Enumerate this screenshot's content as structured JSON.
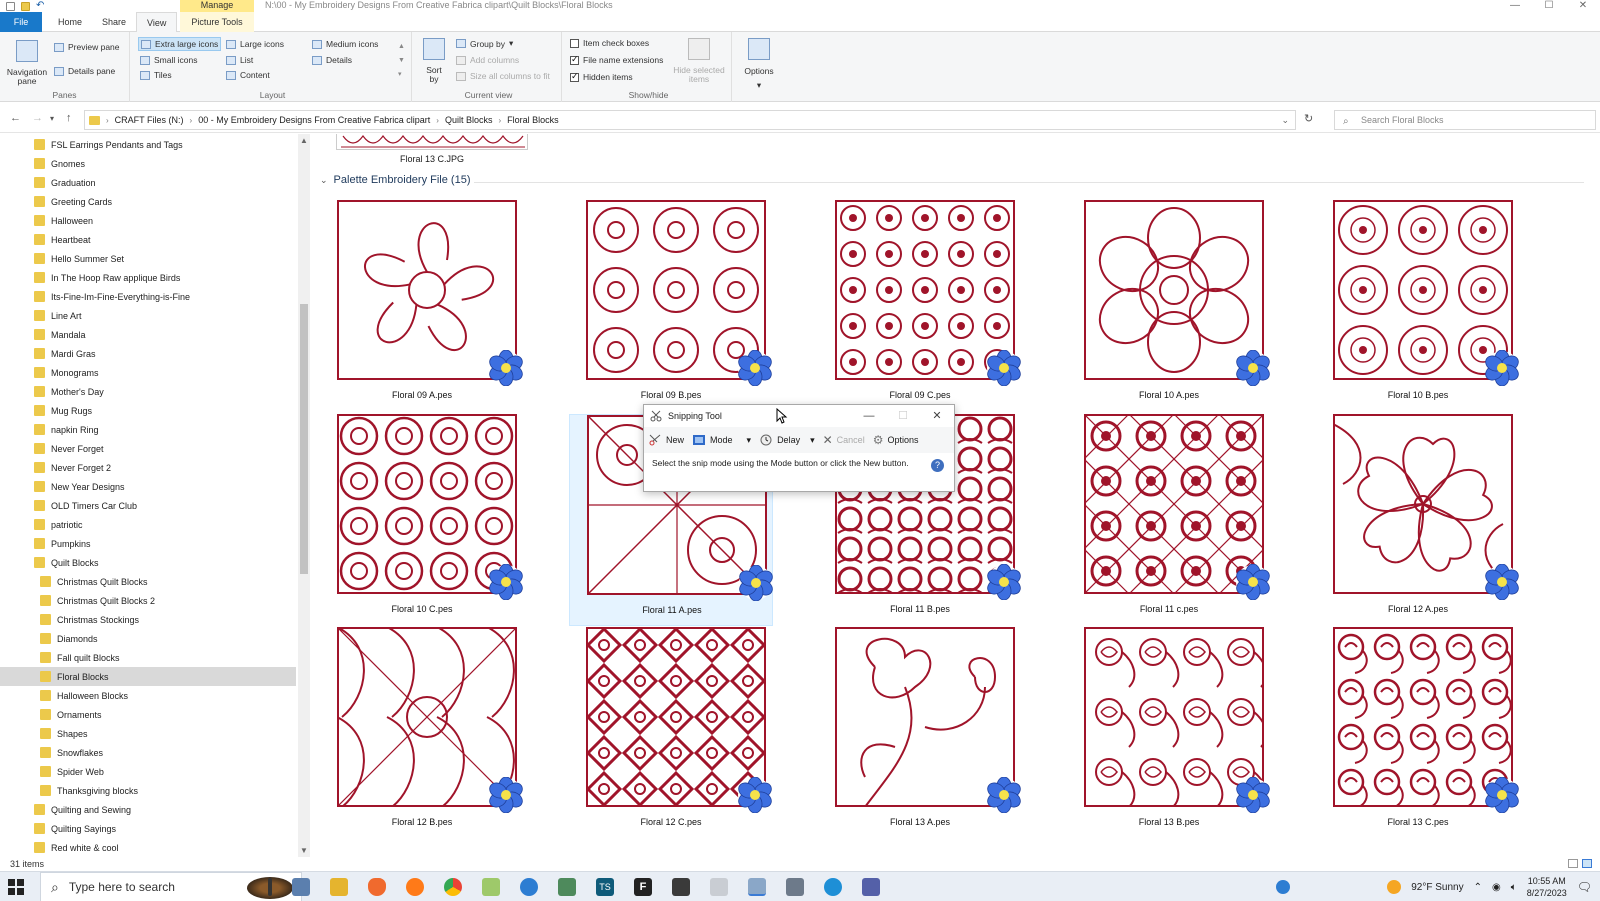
{
  "titlebar": {
    "manage_label": "Manage",
    "path": "N:\\00 - My Embroidery Designs From Creative Fabrica clipart\\Quilt Blocks\\Floral Blocks",
    "min": "—",
    "max": "☐",
    "close": "✕"
  },
  "tabs": {
    "file": "File",
    "home": "Home",
    "share": "Share",
    "view": "View",
    "picture_tools": "Picture Tools"
  },
  "ribbon": {
    "panes": {
      "label": "Panes",
      "navigation_pane": "Navigation pane",
      "preview_pane": "Preview pane",
      "details_pane": "Details pane"
    },
    "layout": {
      "label": "Layout",
      "extra_large_icons": "Extra large icons",
      "large_icons": "Large icons",
      "medium_icons": "Medium icons",
      "small_icons": "Small icons",
      "list": "List",
      "details": "Details",
      "tiles": "Tiles",
      "content": "Content"
    },
    "current_view": {
      "label": "Current view",
      "sort_by": "Sort by",
      "group_by": "Group by",
      "add_columns": "Add columns",
      "size_all_columns": "Size all columns to fit"
    },
    "show_hide": {
      "label": "Show/hide",
      "item_check_boxes": "Item check boxes",
      "file_name_extensions": "File name extensions",
      "hidden_items": "Hidden items",
      "hide_selected_items": "Hide selected items",
      "item_check_boxes_checked": false,
      "file_name_extensions_checked": true,
      "hidden_items_checked": true
    },
    "options": "Options"
  },
  "address": {
    "crumbs": [
      "CRAFT Files (N:)",
      "00 - My Embroidery Designs From Creative Fabrica clipart",
      "Quilt Blocks",
      "Floral Blocks"
    ],
    "search_placeholder": "Search Floral Blocks"
  },
  "navpane": {
    "items": [
      {
        "label": "FSL Earrings Pendants and Tags",
        "indent": 0
      },
      {
        "label": "Gnomes",
        "indent": 0
      },
      {
        "label": "Graduation",
        "indent": 0
      },
      {
        "label": "Greeting Cards",
        "indent": 0
      },
      {
        "label": "Halloween",
        "indent": 0
      },
      {
        "label": "Heartbeat",
        "indent": 0
      },
      {
        "label": "Hello Summer Set",
        "indent": 0
      },
      {
        "label": "In The Hoop Raw applique Birds",
        "indent": 0
      },
      {
        "label": "Its-Fine-Im-Fine-Everything-is-Fine",
        "indent": 0
      },
      {
        "label": "Line Art",
        "indent": 0
      },
      {
        "label": "Mandala",
        "indent": 0
      },
      {
        "label": "Mardi Gras",
        "indent": 0
      },
      {
        "label": "Monograms",
        "indent": 0
      },
      {
        "label": "Mother's Day",
        "indent": 0
      },
      {
        "label": "Mug Rugs",
        "indent": 0
      },
      {
        "label": "napkin Ring",
        "indent": 0
      },
      {
        "label": "Never Forget",
        "indent": 0
      },
      {
        "label": "Never Forget 2",
        "indent": 0
      },
      {
        "label": "New Year Designs",
        "indent": 0
      },
      {
        "label": "OLD Timers Car Club",
        "indent": 0
      },
      {
        "label": "patriotic",
        "indent": 0
      },
      {
        "label": "Pumpkins",
        "indent": 0
      },
      {
        "label": "Quilt Blocks",
        "indent": 0
      },
      {
        "label": "Christmas Quilt Blocks",
        "indent": 1
      },
      {
        "label": "Christmas Quilt Blocks 2",
        "indent": 1
      },
      {
        "label": "Christmas Stockings",
        "indent": 1
      },
      {
        "label": "Diamonds",
        "indent": 1
      },
      {
        "label": "Fall quilt Blocks",
        "indent": 1
      },
      {
        "label": "Floral Blocks",
        "indent": 1,
        "selected": true
      },
      {
        "label": "Halloween Blocks",
        "indent": 1
      },
      {
        "label": "Ornaments",
        "indent": 1
      },
      {
        "label": "Shapes",
        "indent": 1
      },
      {
        "label": "Snowflakes",
        "indent": 1
      },
      {
        "label": "Spider Web",
        "indent": 1
      },
      {
        "label": "Thanksgiving blocks",
        "indent": 1
      },
      {
        "label": "Quilting and Sewing",
        "indent": 0
      },
      {
        "label": "Quilting Sayings",
        "indent": 0
      },
      {
        "label": "Red white & cool",
        "indent": 0
      }
    ]
  },
  "content": {
    "prev_file_label": "Floral 13 C.JPG",
    "group_header": "Palette Embroidery File (15)",
    "files": [
      {
        "label": "Floral 09 A.pes",
        "pattern": "flower5"
      },
      {
        "label": "Floral 09 B.pes",
        "pattern": "quatrefoil"
      },
      {
        "label": "Floral 09 C.pes",
        "pattern": "smallflowers"
      },
      {
        "label": "Floral 10 A.pes",
        "pattern": "bigflower"
      },
      {
        "label": "Floral 10 B.pes",
        "pattern": "medallion"
      },
      {
        "label": "Floral 10 C.pes",
        "pattern": "grid9"
      },
      {
        "label": "Floral 11 A.pes",
        "pattern": "diag",
        "hover": true
      },
      {
        "label": "Floral 11 B.pes",
        "pattern": "dense"
      },
      {
        "label": "Floral 11 c.pes",
        "pattern": "lattice"
      },
      {
        "label": "Floral 12 A.pes",
        "pattern": "hibiscus"
      },
      {
        "label": "Floral 12 B.pes",
        "pattern": "leaves"
      },
      {
        "label": "Floral 12 C.pes",
        "pattern": "dense2"
      },
      {
        "label": "Floral 13 A.pes",
        "pattern": "rose"
      },
      {
        "label": "Floral 13 B.pes",
        "pattern": "roses"
      },
      {
        "label": "Floral 13 C.pes",
        "pattern": "roses2"
      }
    ]
  },
  "snipping": {
    "title": "Snipping Tool",
    "new": "New",
    "mode": "Mode",
    "delay": "Delay",
    "cancel": "Cancel",
    "options": "Options",
    "message": "Select the snip mode using the Mode button or click the New button.",
    "help": "?"
  },
  "status": {
    "items_count": "31 items"
  },
  "taskbar": {
    "search_placeholder": "Type here to search",
    "weather": "92°F  Sunny",
    "time": "10:55 AM",
    "date": "8/27/2023"
  },
  "colors": {
    "stitch": "#a0142a",
    "accent": "#1979ca",
    "badge": "#3d6fe0"
  }
}
